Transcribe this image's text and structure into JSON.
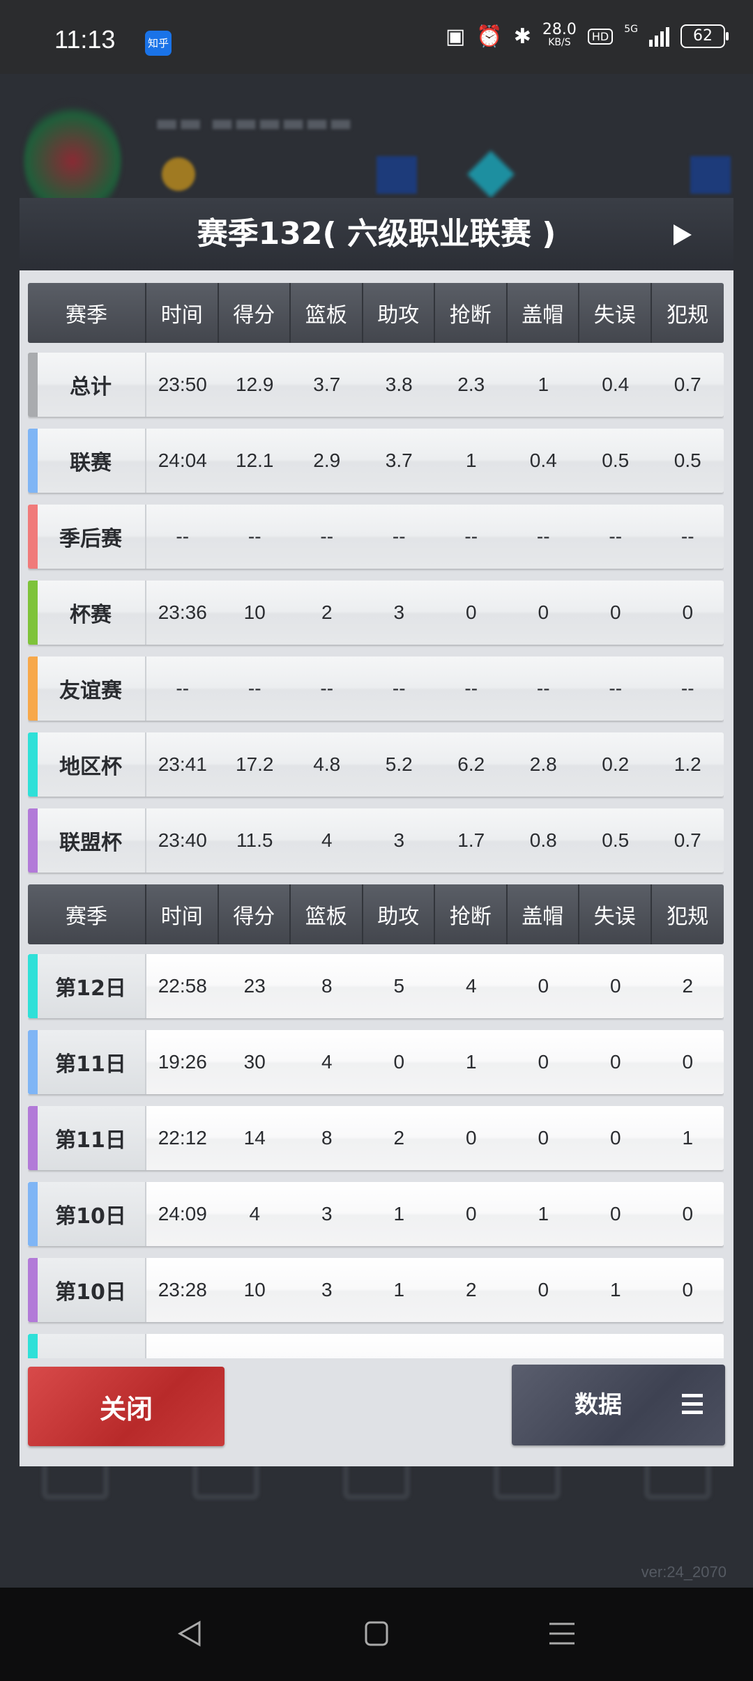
{
  "status_bar": {
    "time": "11:13",
    "app_badge": "知乎",
    "net_speed_value": "28.0",
    "net_speed_unit": "KB/S",
    "hd_label": "HD",
    "network_type": "5G",
    "battery_level": "62"
  },
  "modal": {
    "title": "赛季132( 六级职业联赛 )"
  },
  "summary_table": {
    "columns": [
      "赛季",
      "时间",
      "得分",
      "篮板",
      "助攻",
      "抢断",
      "盖帽",
      "失误",
      "犯规"
    ],
    "rows": [
      {
        "label": "总计",
        "accent": "#a9abae",
        "values": [
          "23:50",
          "12.9",
          "3.7",
          "3.8",
          "2.3",
          "1",
          "0.4",
          "0.7"
        ]
      },
      {
        "label": "联赛",
        "accent": "#7fb5f5",
        "values": [
          "24:04",
          "12.1",
          "2.9",
          "3.7",
          "1",
          "0.4",
          "0.5",
          "0.5"
        ]
      },
      {
        "label": "季后赛",
        "accent": "#f07a7a",
        "values": [
          "--",
          "--",
          "--",
          "--",
          "--",
          "--",
          "--",
          "--"
        ]
      },
      {
        "label": "杯赛",
        "accent": "#7ec33a",
        "values": [
          "23:36",
          "10",
          "2",
          "3",
          "0",
          "0",
          "0",
          "0"
        ]
      },
      {
        "label": "友谊赛",
        "accent": "#f7a84a",
        "values": [
          "--",
          "--",
          "--",
          "--",
          "--",
          "--",
          "--",
          "--"
        ]
      },
      {
        "label": "地区杯",
        "accent": "#2fe0d8",
        "values": [
          "23:41",
          "17.2",
          "4.8",
          "5.2",
          "6.2",
          "2.8",
          "0.2",
          "1.2"
        ]
      },
      {
        "label": "联盟杯",
        "accent": "#b27ad8",
        "values": [
          "23:40",
          "11.5",
          "4",
          "3",
          "1.7",
          "0.8",
          "0.5",
          "0.7"
        ]
      }
    ]
  },
  "game_table": {
    "columns": [
      "赛季",
      "时间",
      "得分",
      "篮板",
      "助攻",
      "抢断",
      "盖帽",
      "失误",
      "犯规"
    ],
    "rows": [
      {
        "label": "第12日",
        "accent": "#2fe0d8",
        "values": [
          "22:58",
          "23",
          "8",
          "5",
          "4",
          "0",
          "0",
          "2"
        ]
      },
      {
        "label": "第11日",
        "accent": "#7fb5f5",
        "values": [
          "19:26",
          "30",
          "4",
          "0",
          "1",
          "0",
          "0",
          "0"
        ]
      },
      {
        "label": "第11日",
        "accent": "#b27ad8",
        "values": [
          "22:12",
          "14",
          "8",
          "2",
          "0",
          "0",
          "0",
          "1"
        ]
      },
      {
        "label": "第10日",
        "accent": "#7fb5f5",
        "values": [
          "24:09",
          "4",
          "3",
          "1",
          "0",
          "1",
          "0",
          "0"
        ]
      },
      {
        "label": "第10日",
        "accent": "#b27ad8",
        "values": [
          "23:28",
          "10",
          "3",
          "1",
          "2",
          "0",
          "1",
          "0"
        ]
      },
      {
        "label": "",
        "accent": "#2fe0d8",
        "values": [
          "",
          "",
          "",
          "",
          "",
          "",
          "",
          ""
        ]
      }
    ]
  },
  "buttons": {
    "close_label": "关闭",
    "data_label": "数据"
  },
  "footer": {
    "version": "ver:24_2070"
  }
}
